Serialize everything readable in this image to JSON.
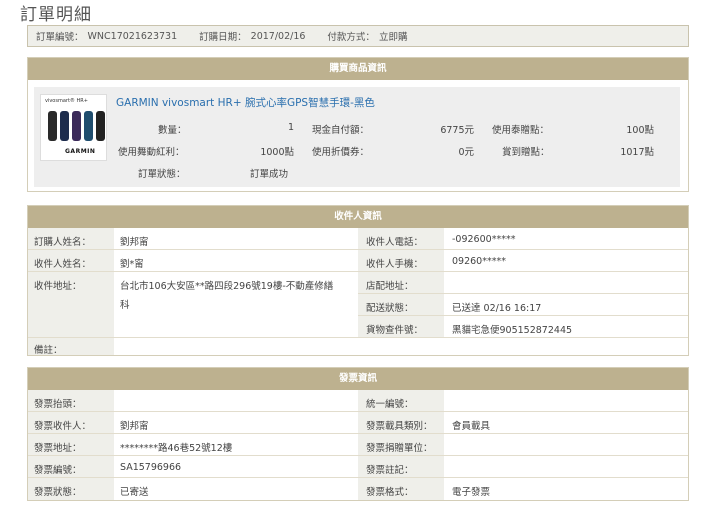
{
  "page_title": "訂單明細",
  "order": {
    "no_label": "訂單編號：",
    "no_value": "WNC17021623731",
    "date_label": "訂購日期：",
    "date_value": "2017/02/16",
    "pay_label": "付款方式：",
    "pay_value": "立即購"
  },
  "purchase": {
    "header": "購買商品資訊",
    "image_caption": "vivosmart® HR+",
    "image_brand": "GARMIN",
    "product_name": "GARMIN vivosmart HR+ 腕式心率GPS智慧手環-黑色",
    "qty_label": "數量：",
    "qty_value": "1",
    "cash_label": "現金自付額：",
    "cash_value": "6775元",
    "points_used_label": "使用泰贈點：",
    "points_used_value": "100點",
    "bonus_label": "使用舞動紅利：",
    "bonus_value": "1000點",
    "coupon_label": "使用折價券：",
    "coupon_value": "0元",
    "earned_label": "賞到贈點：",
    "earned_value": "1017點",
    "status_label": "訂單狀態：",
    "status_value": "訂單成功"
  },
  "recipient": {
    "header": "收件人資訊",
    "buyer_name_label": "訂購人姓名：",
    "buyer_name_value": "劉邦甯",
    "phone_label": "收件人電話：",
    "phone_value": "-092600*****",
    "recv_name_label": "收件人姓名：",
    "recv_name_value": "劉*甯",
    "mobile_label": "收件人手機：",
    "mobile_value": "09260*****",
    "addr_label": "收件地址：",
    "addr_value_1": "台北市106大安區**路四段296號19樓-不動產修繕",
    "addr_value_2": "科",
    "store_label": "店配地址：",
    "store_value": "",
    "ship_label": "配送狀態：",
    "ship_value": "已送達 02/16 16:17",
    "track_label": "貨物查件號：",
    "track_value": "黑貓宅急便905152872445",
    "note_label": "備註："
  },
  "invoice": {
    "header": "發票資訊",
    "title_label": "發票抬頭：",
    "title_value": "",
    "unified_label": "統一編號：",
    "unified_value": "",
    "recv_label": "發票收件人：",
    "recv_value": "劉邦甯",
    "carrier_label": "發票載具類別：",
    "carrier_value": "會員載具",
    "addr_label": "發票地址：",
    "addr_value": "********路46巷52號12樓",
    "donate_label": "發票捐贈單位：",
    "donate_value": "",
    "no_label": "發票編號：",
    "no_value": "SA15796966",
    "remark_label": "發票註記：",
    "remark_value": "",
    "status_label": "發票狀態：",
    "status_value": "已寄送",
    "format_label": "發票格式：",
    "format_value": "電子發票"
  }
}
